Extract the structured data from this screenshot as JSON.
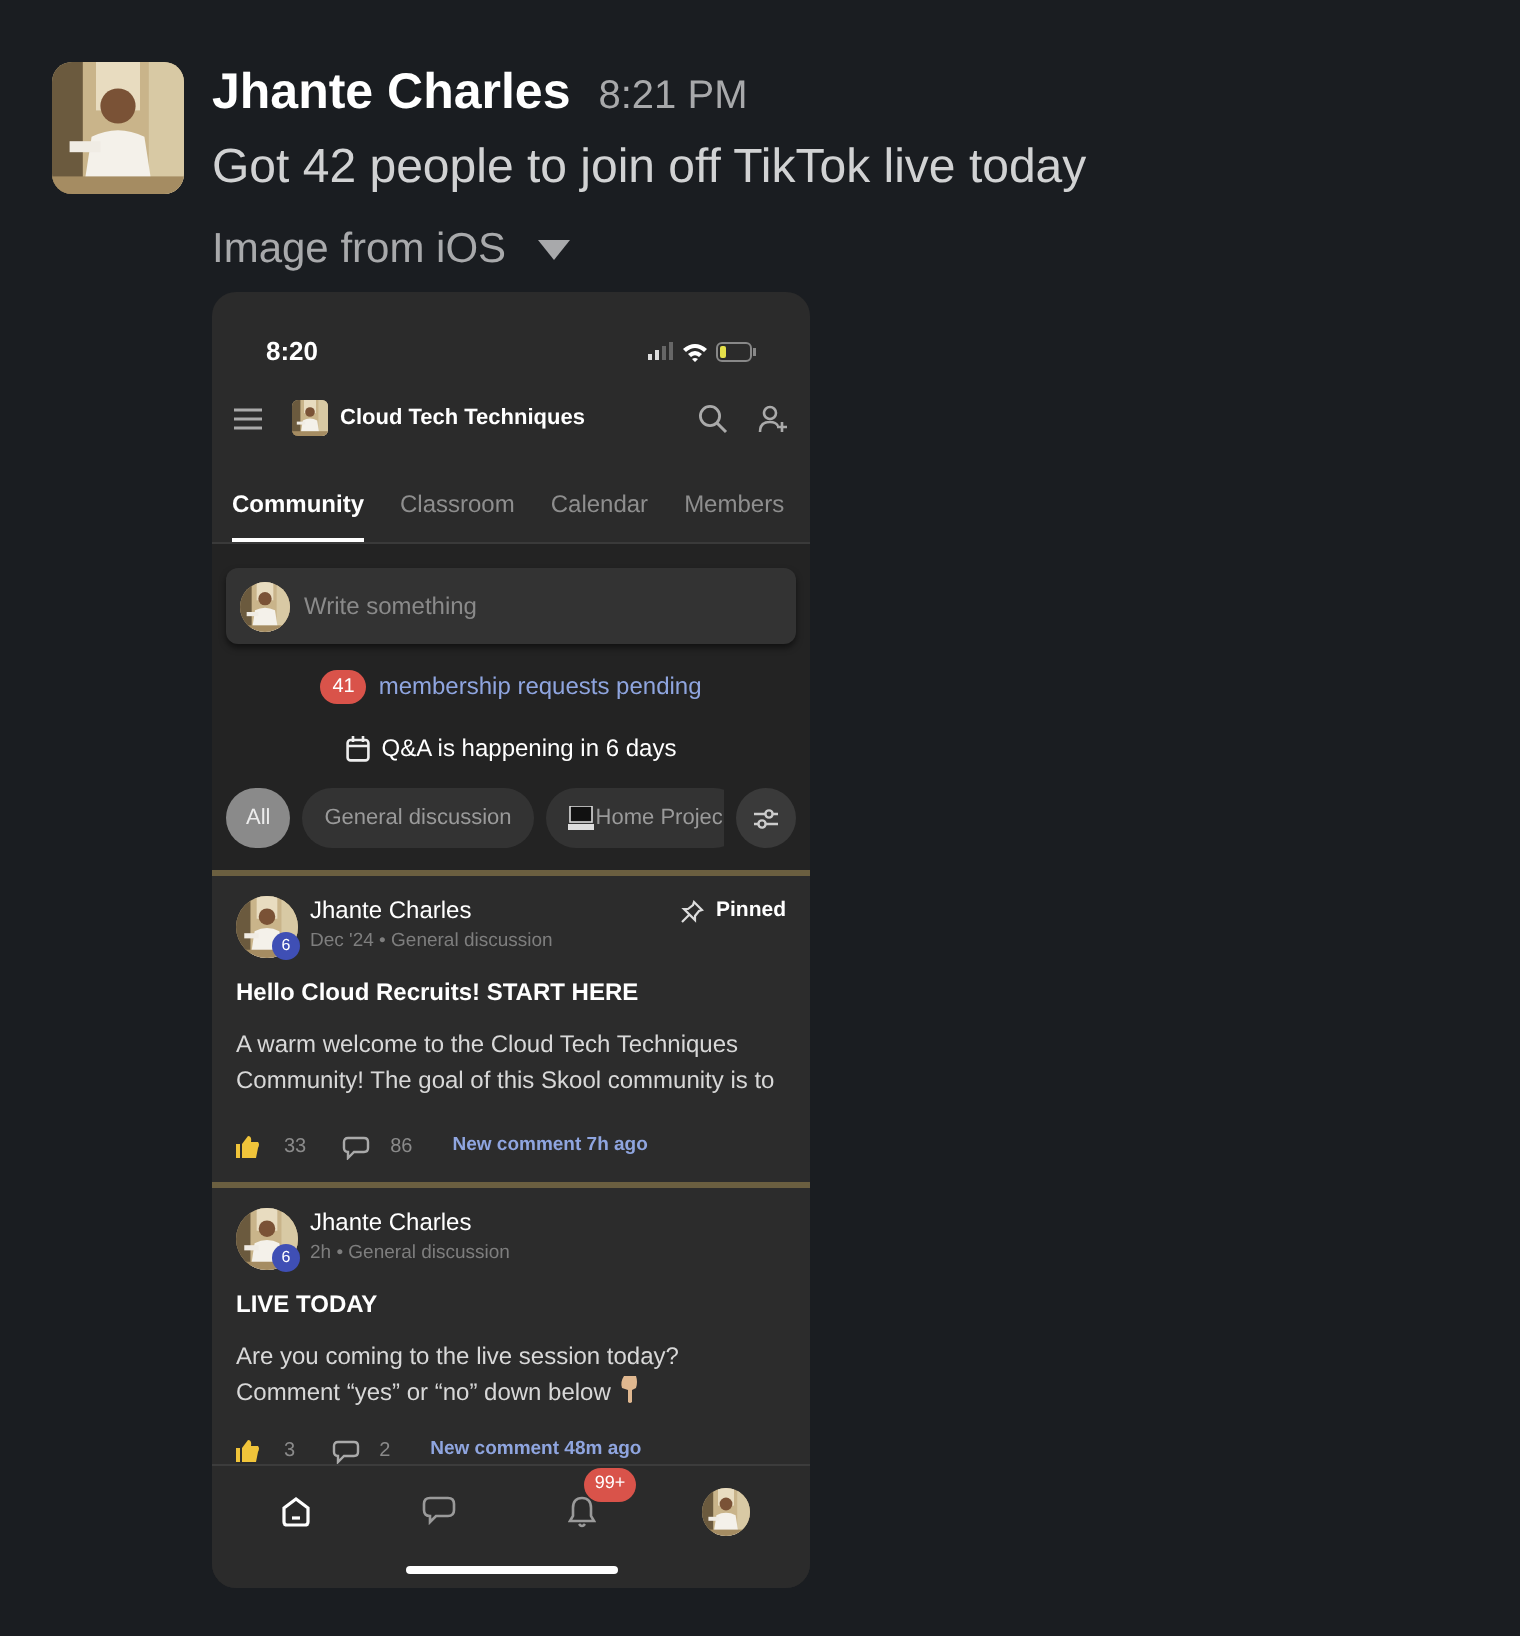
{
  "message": {
    "author": "Jhante Charles",
    "time": "8:21 PM",
    "text": "Got 42 people to join off TikTok live today",
    "attachment_label": "Image from iOS"
  },
  "phone": {
    "status_time": "8:20",
    "community_name": "Cloud Tech Techniques",
    "tabs": [
      {
        "label": "Community",
        "selected": true
      },
      {
        "label": "Classroom",
        "selected": false
      },
      {
        "label": "Calendar",
        "selected": false
      },
      {
        "label": "Members",
        "selected": false
      }
    ],
    "composer": {
      "placeholder": "Write something"
    },
    "pending": {
      "count": "41",
      "text": "membership requests pending"
    },
    "event": {
      "text": "Q&A is happening in 6 days"
    },
    "chips": [
      {
        "label": "All",
        "selected": true,
        "kind": "plain"
      },
      {
        "label": "General discussion",
        "selected": false,
        "kind": "plain"
      },
      {
        "label": "Home Projec",
        "selected": false,
        "kind": "laptop"
      }
    ],
    "posts": [
      {
        "author": "Jhante Charles",
        "level": "6",
        "meta": "Dec '24 • General discussion",
        "pinned": true,
        "pinned_label": "Pinned",
        "title": "Hello Cloud Recruits! START HERE",
        "body": "A warm welcome to the Cloud Tech Techniques Community! The goal of this Skool community is to",
        "pointing_emoji": false,
        "likes": "33",
        "comments": "86",
        "new_comment": "New comment 7h ago"
      },
      {
        "author": "Jhante Charles",
        "level": "6",
        "meta": "2h • General discussion",
        "pinned": false,
        "title": "LIVE TODAY",
        "body": "Are you coming to the live session today? Comment “yes” or “no” down below",
        "pointing_emoji": true,
        "likes": "3",
        "comments": "2",
        "new_comment": "New comment 48m ago"
      }
    ],
    "nav": [
      {
        "kind": "home",
        "selected": true
      },
      {
        "kind": "chat",
        "selected": false
      },
      {
        "kind": "bell",
        "selected": false,
        "badge": "99+"
      },
      {
        "kind": "avatar",
        "selected": false
      }
    ]
  }
}
